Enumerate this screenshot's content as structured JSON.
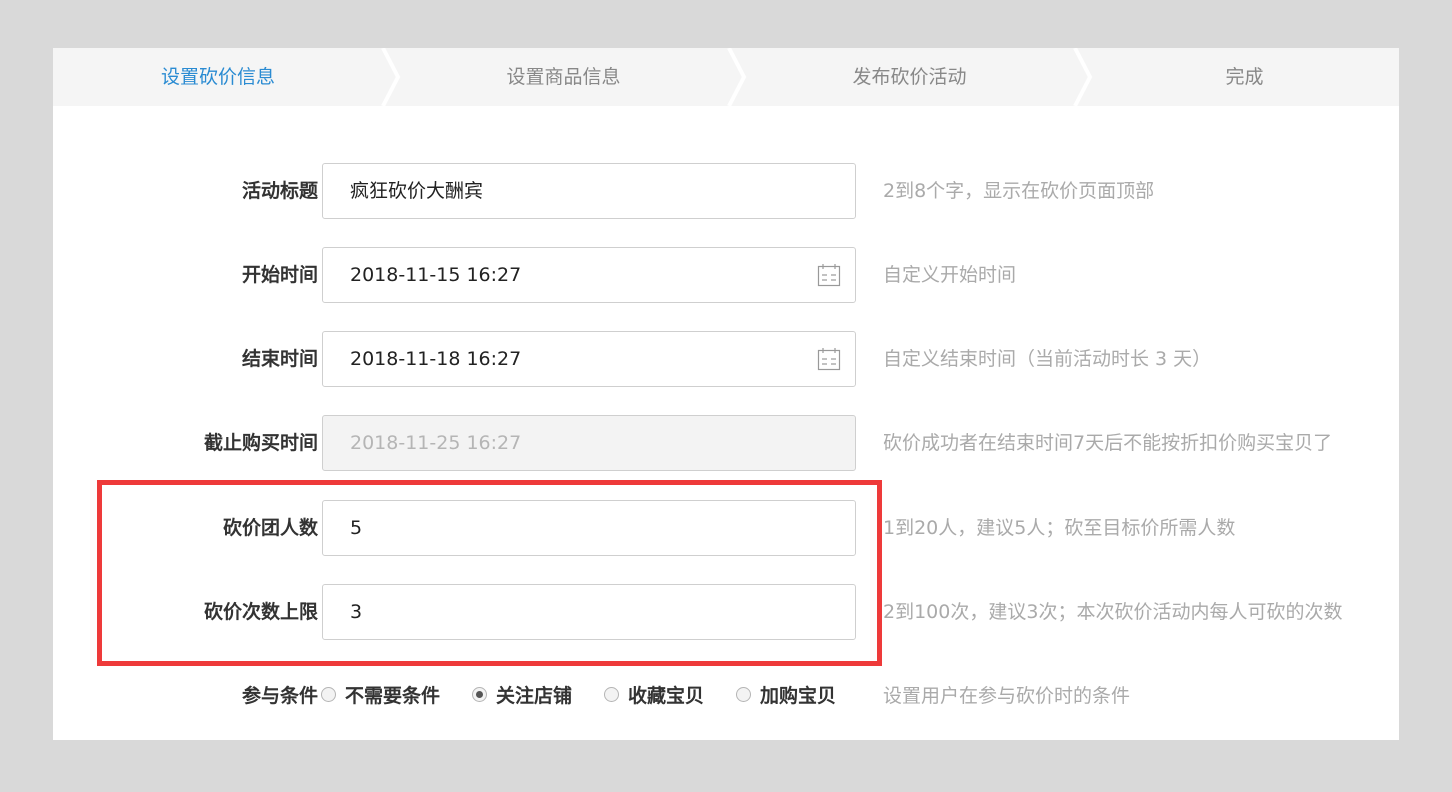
{
  "steps": [
    {
      "label": "设置砍价信息",
      "active": true
    },
    {
      "label": "设置商品信息",
      "active": false
    },
    {
      "label": "发布砍价活动",
      "active": false
    },
    {
      "label": "完成",
      "active": false
    }
  ],
  "form": {
    "title": {
      "label": "活动标题",
      "value": "疯狂砍价大酬宾",
      "hint": "2到8个字，显示在砍价页面顶部"
    },
    "start": {
      "label": "开始时间",
      "value": "2018-11-15 16:27",
      "hint": "自定义开始时间"
    },
    "end": {
      "label": "结束时间",
      "value": "2018-11-18 16:27",
      "hint": "自定义结束时间（当前活动时长 3 天）"
    },
    "deadline": {
      "label": "截止购买时间",
      "value": "2018-11-25 16:27",
      "hint": "砍价成功者在结束时间7天后不能按折扣价购买宝贝了"
    },
    "group_size": {
      "label": "砍价团人数",
      "value": "5",
      "hint": "1到20人，建议5人；砍至目标价所需人数"
    },
    "cut_limit": {
      "label": "砍价次数上限",
      "value": "3",
      "hint": "2到100次，建议3次；本次砍价活动内每人可砍的次数"
    },
    "condition": {
      "label": "参与条件",
      "options": [
        {
          "label": "不需要条件",
          "checked": false
        },
        {
          "label": "关注店铺",
          "checked": true
        },
        {
          "label": "收藏宝贝",
          "checked": false
        },
        {
          "label": "加购宝贝",
          "checked": false
        }
      ],
      "hint": "设置用户在参与砍价时的条件"
    }
  },
  "colors": {
    "active_step": "#2a8bd2",
    "highlight": "#ee3a3a"
  },
  "icons": {
    "date_picker": "calendar-icon"
  }
}
